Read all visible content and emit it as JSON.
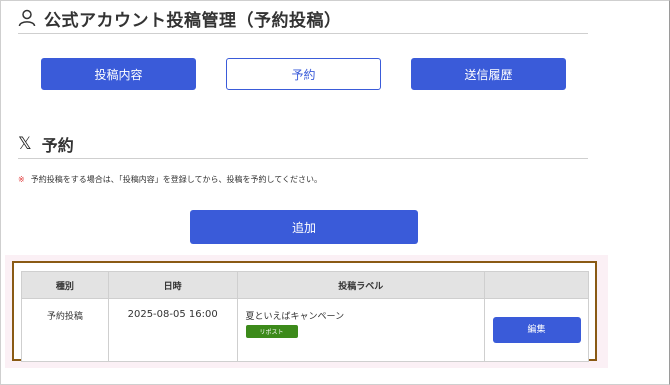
{
  "header": {
    "title": "公式アカウント投稿管理（予約投稿）",
    "icon": "user-icon"
  },
  "nav": {
    "post_content": "投稿内容",
    "reservation": "予約",
    "history": "送信履歴"
  },
  "section": {
    "logo": "𝕏",
    "title": "予約"
  },
  "notice": {
    "mark": "※",
    "text": "予約投稿をする場合は、「投稿内容」を登録してから、投稿を予約してください。"
  },
  "add_button": "追加",
  "table": {
    "headers": {
      "type": "種別",
      "datetime": "日時",
      "label": "投稿ラベル",
      "action": ""
    },
    "rows": [
      {
        "type": "予約投稿",
        "datetime": "2025-08-05 16:00",
        "label": "夏といえばキャンペーン",
        "tag": "リポスト",
        "action": "編集"
      }
    ]
  },
  "colors": {
    "primary": "#3a5bd9",
    "tag_green": "#3c8a1a",
    "highlight_border": "#8a5a14"
  }
}
